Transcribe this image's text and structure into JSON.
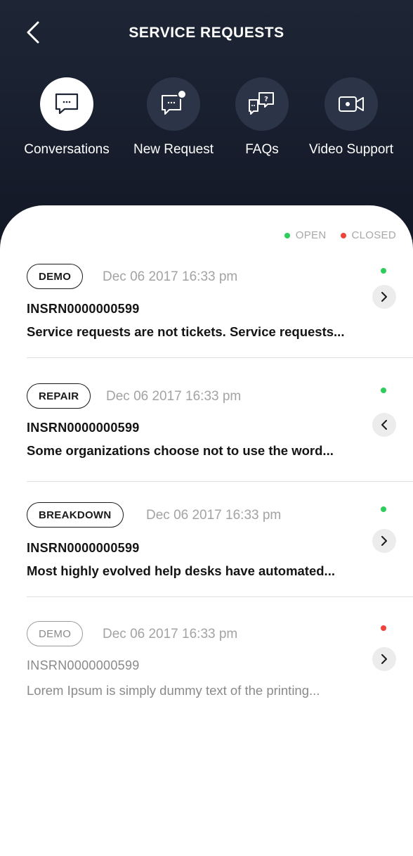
{
  "header": {
    "title": "SERVICE REQUESTS"
  },
  "nav": [
    {
      "label": "Conversations",
      "icon": "chat-bubble-icon",
      "active": true
    },
    {
      "label": "New Request",
      "icon": "new-message-icon",
      "active": false
    },
    {
      "label": "FAQs",
      "icon": "faq-bubbles-icon",
      "active": false
    },
    {
      "label": "Video Support",
      "icon": "video-camera-icon",
      "active": false
    }
  ],
  "legend": {
    "open_label": "OPEN",
    "closed_label": "CLOSED",
    "open_color": "#2ecc5a",
    "closed_color": "#f0443a"
  },
  "requests": [
    {
      "badge": "DEMO",
      "date": "Dec 06 2017 16:33 pm",
      "ref": "INSRN0000000599",
      "desc": "Service requests are not tickets. Service requests...",
      "status": "open",
      "chevron": "right"
    },
    {
      "badge": "REPAIR",
      "date": "Dec 06 2017 16:33 pm",
      "ref": "INSRN0000000599",
      "desc": "Some organizations choose not to use the word...",
      "status": "open",
      "chevron": "left"
    },
    {
      "badge": "BREAKDOWN",
      "date": "Dec 06 2017 16:33 pm",
      "ref": "INSRN0000000599",
      "desc": "Most highly evolved help desks have automated...",
      "status": "open",
      "chevron": "right"
    },
    {
      "badge": "DEMO",
      "date": "Dec 06 2017 16:33 pm",
      "ref": "INSRN0000000599",
      "desc": "Lorem Ipsum is simply dummy text of the printing...",
      "status": "closed",
      "chevron": "right"
    }
  ]
}
